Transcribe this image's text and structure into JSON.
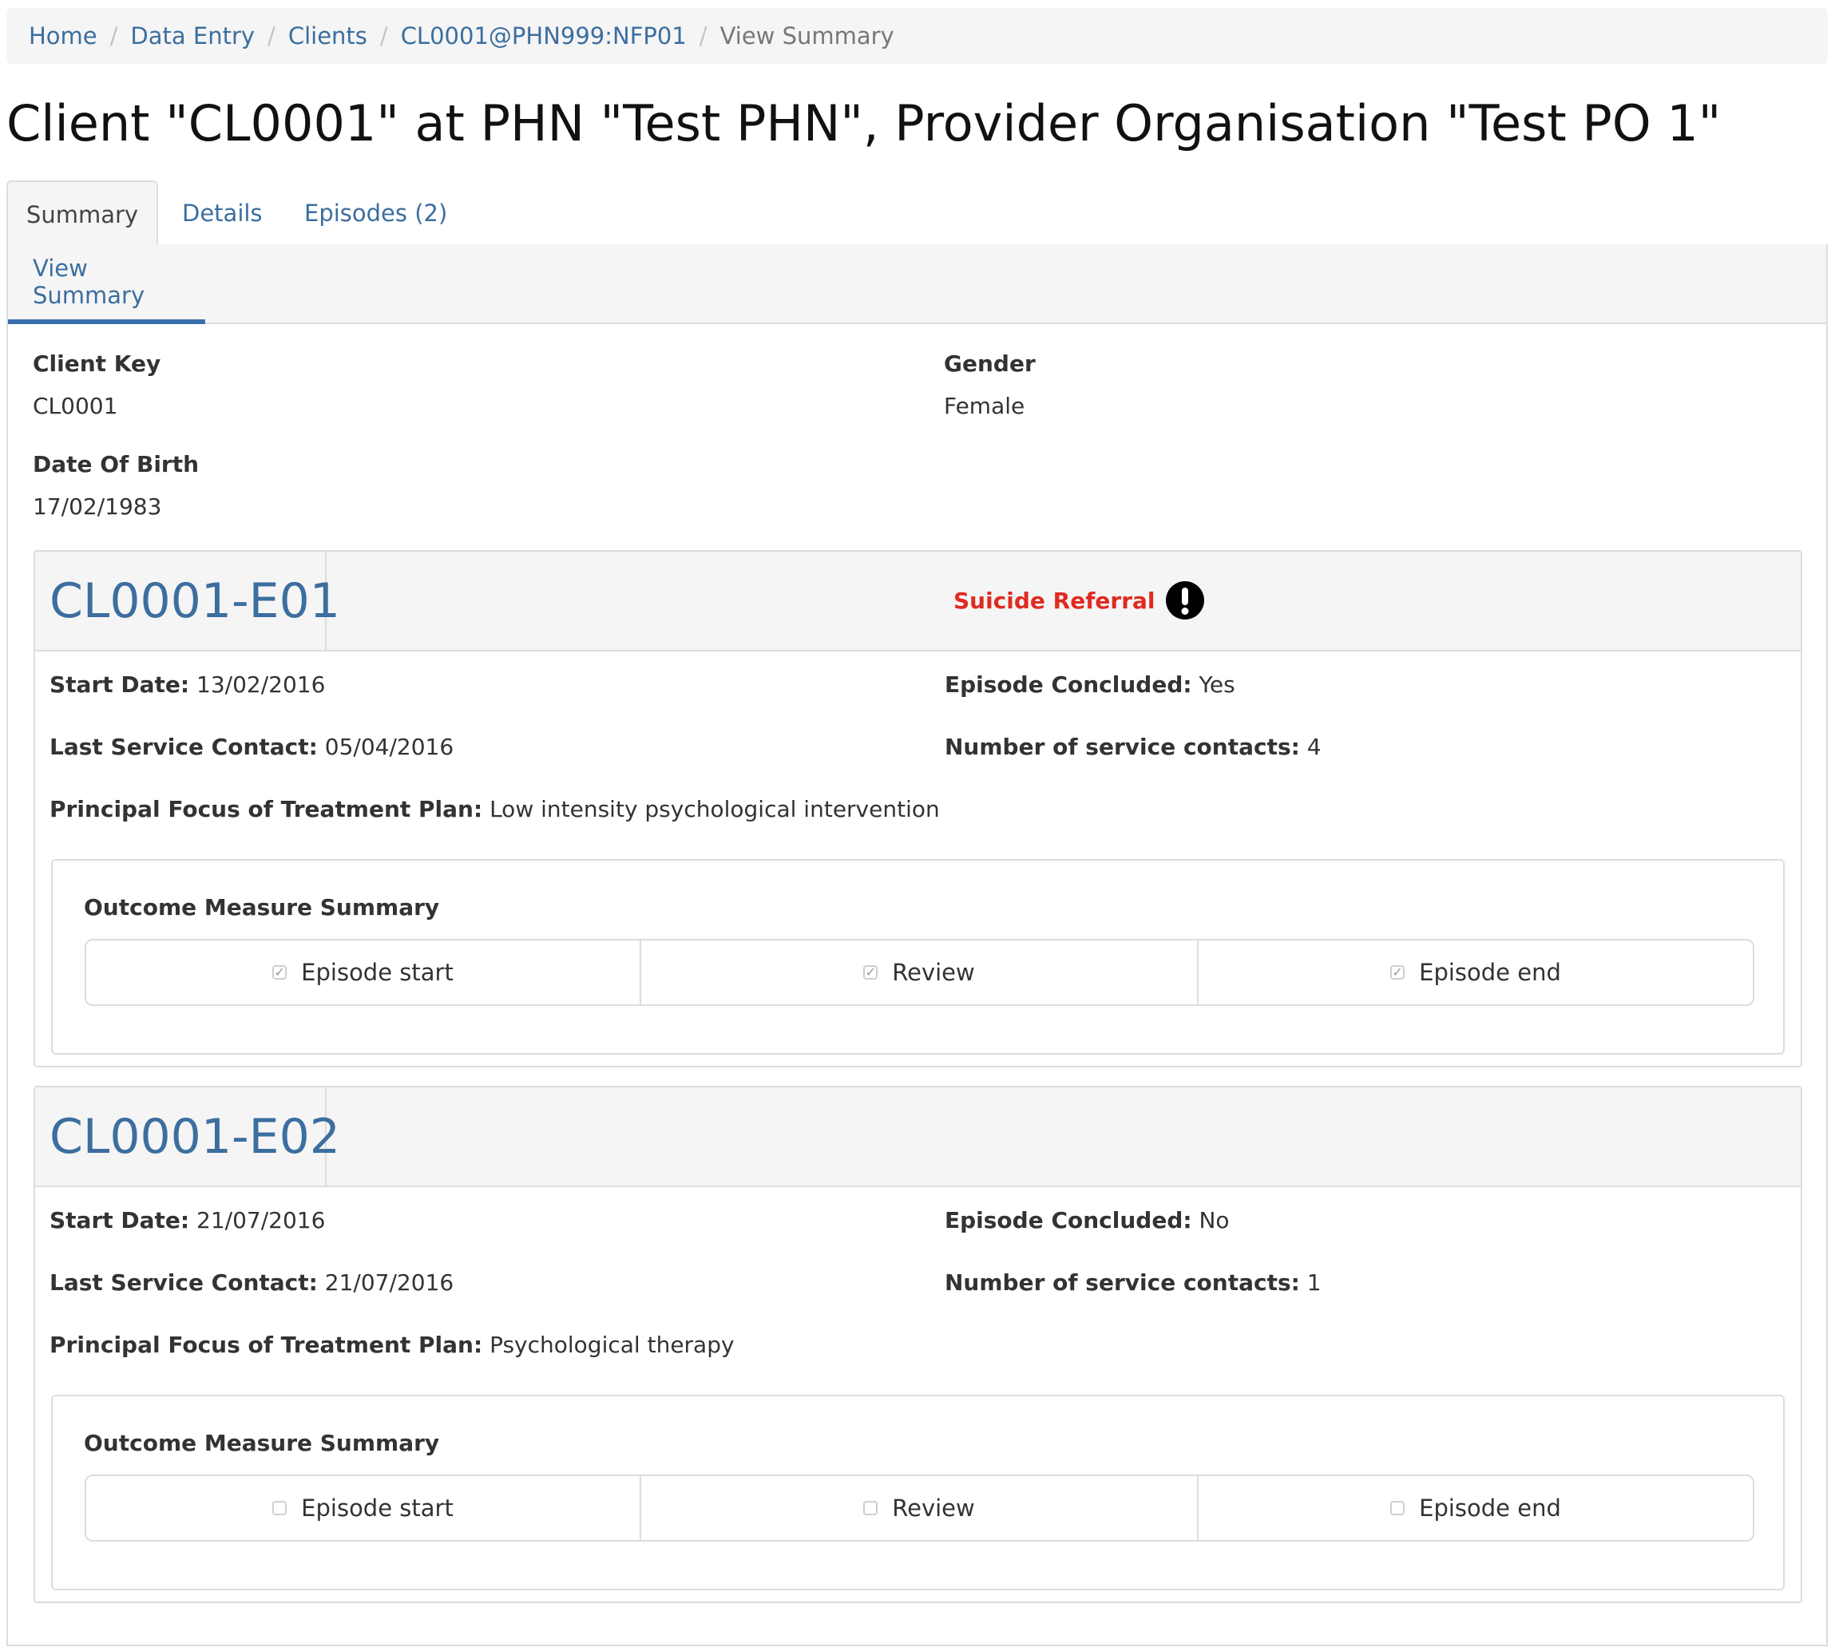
{
  "breadcrumb": {
    "items": [
      "Home",
      "Data Entry",
      "Clients",
      "CL0001@PHN999:NFP01"
    ],
    "active": "View Summary",
    "separator": "/"
  },
  "page": {
    "title": "Client \"CL0001\" at PHN \"Test PHN\", Provider Organisation \"Test PO 1\""
  },
  "tabs": {
    "summary": "Summary",
    "details": "Details",
    "episodes": "Episodes (2)",
    "active": "Summary"
  },
  "subnav": {
    "view_summary": "View Summary"
  },
  "client": {
    "client_key_label": "Client Key",
    "client_key": "CL0001",
    "gender_label": "Gender",
    "gender": "Female",
    "dob_label": "Date Of Birth",
    "dob": "17/02/1983"
  },
  "labels": {
    "start_date": "Start Date:",
    "last_service_contact": "Last Service Contact:",
    "principal_focus": "Principal Focus of Treatment Plan:",
    "episode_concluded": "Episode Concluded:",
    "number_of_contacts": "Number of service contacts:",
    "outcome_title": "Outcome Measure Summary",
    "episode_start": "Episode start",
    "review": "Review",
    "episode_end": "Episode end"
  },
  "episodes": [
    {
      "id": "CL0001-E01",
      "alert": "Suicide Referral",
      "alert_icon": "exclamation-circle-icon",
      "start_date": "13/02/2016",
      "last_service_contact": "05/04/2016",
      "principal_focus": "Low intensity psychological intervention",
      "episode_concluded": "Yes",
      "number_of_contacts": "4",
      "outcomes": {
        "episode_start": true,
        "review": true,
        "episode_end": true
      }
    },
    {
      "id": "CL0001-E02",
      "alert": "",
      "start_date": "21/07/2016",
      "last_service_contact": "21/07/2016",
      "principal_focus": "Psychological therapy",
      "episode_concluded": "No",
      "number_of_contacts": "1",
      "outcomes": {
        "episode_start": false,
        "review": false,
        "episode_end": false
      }
    }
  ],
  "colors": {
    "link": "#3c6e9f",
    "alert": "#e02a20",
    "active_underline": "#3a71ac",
    "panel_bg": "#f5f5f5",
    "border": "#dddddd"
  }
}
